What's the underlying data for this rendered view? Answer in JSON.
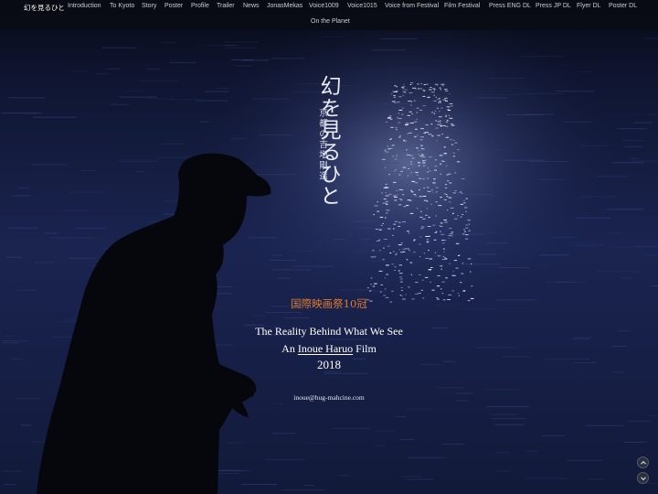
{
  "nav": {
    "brand": "幻を見るひと",
    "items": [
      "Introduction",
      "To Kyoto",
      "Story",
      "Poster",
      "Profile",
      "Trailer",
      "News",
      "JonasMekas",
      "Voice1009",
      "Voice1015",
      "Voice from Festival",
      "Film Festival",
      "Press ENG DL",
      "Press JP DL",
      "Flyer DL",
      "Poster DL"
    ],
    "items_row2": [
      "On the Planet"
    ]
  },
  "hero": {
    "title_vertical": "幻を見るひと",
    "subtitle_vertical": [
      "京都の吉増剛造"
    ],
    "award": "国際映画祭10冠",
    "tagline": "The Reality Behind What We See",
    "film_prefix": "An ",
    "director": "Inoue Haruo",
    "film_suffix": " Film",
    "year": "2018",
    "email": "inoue@hug-mahcine.com"
  },
  "controls": {
    "scroll_up": "chevron-up-icon",
    "scroll_down": "chevron-down-icon"
  },
  "colors": {
    "nav_bg": "#0a0c14",
    "accent_award": "#e07a30",
    "water": "#1b2549"
  }
}
